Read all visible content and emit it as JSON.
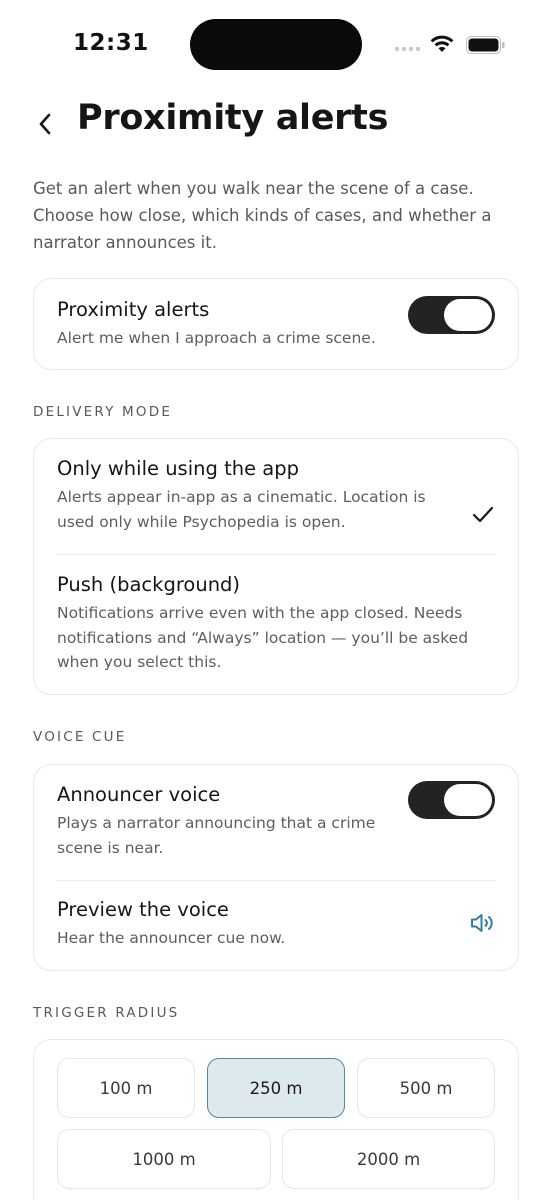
{
  "status_bar": {
    "time": "12:31"
  },
  "header": {
    "title": "Proximity alerts"
  },
  "intro": "Get an alert when you walk near the scene of a case. Choose how close, which kinds of cases, and whether a narrator announces it.",
  "master_toggle": {
    "title": "Proximity alerts",
    "subtitle": "Alert me when I approach a crime scene.",
    "on": true
  },
  "delivery_mode": {
    "label": "DELIVERY MODE",
    "options": [
      {
        "title": "Only while using the app",
        "subtitle": "Alerts appear in-app as a cinematic. Location is used only while Psychopedia is open.",
        "selected": true
      },
      {
        "title": "Push (background)",
        "subtitle": "Notifications arrive even with the app closed. Needs notifications and “Always” location — you’ll be asked when you select this.",
        "selected": false
      }
    ]
  },
  "voice_cue": {
    "label": "VOICE CUE",
    "announcer": {
      "title": "Announcer voice",
      "subtitle": "Plays a narrator announcing that a crime scene is near.",
      "on": true
    },
    "preview": {
      "title": "Preview the voice",
      "subtitle": "Hear the announcer cue now.",
      "icon": "speaker-icon"
    }
  },
  "trigger_radius": {
    "label": "TRIGGER RADIUS",
    "options": [
      "100 m",
      "250 m",
      "500 m",
      "1000 m",
      "2000 m"
    ],
    "selected": "250 m"
  },
  "colors": {
    "accent": "#2f7f9e",
    "selected_chip_bg": "#dde9ee",
    "toggle_on": "#232323"
  }
}
